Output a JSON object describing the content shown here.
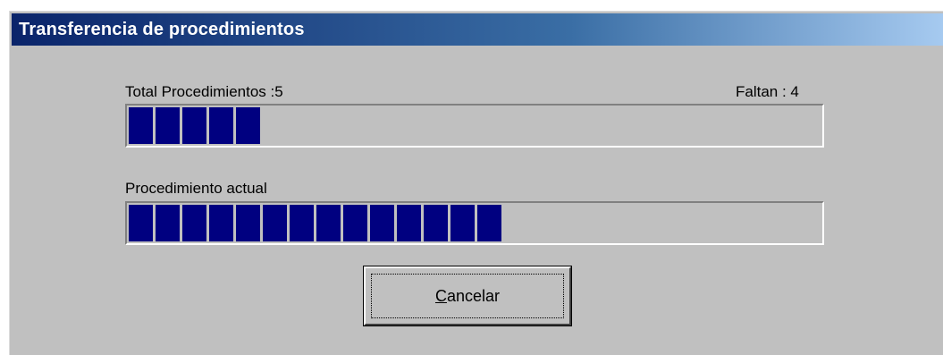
{
  "window": {
    "title": "Transferencia de procedimientos"
  },
  "total": {
    "label": "Total Procedimientos :5",
    "remaining_label": "Faltan : 4",
    "progress_blocks_filled": 5,
    "progress_fraction": 0.2
  },
  "current": {
    "label": "Procedimiento actual",
    "progress_blocks_filled": 14,
    "progress_fraction": 0.56
  },
  "buttons": {
    "cancel_mnemonic": "C",
    "cancel_rest": "ancelar"
  },
  "colors": {
    "titlebar_start": "#0a246a",
    "titlebar_end": "#a6caf0",
    "dialog_bg": "#c0c0c0",
    "progress_fill": "#000080"
  }
}
